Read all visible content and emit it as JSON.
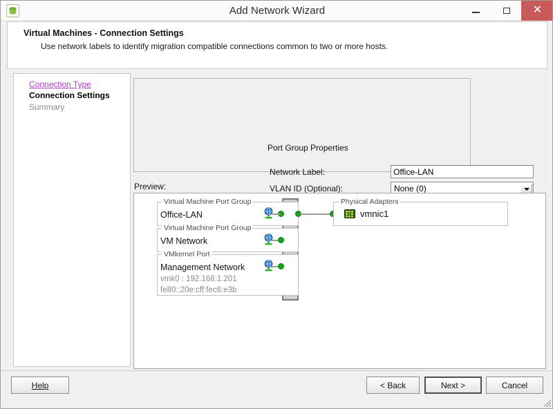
{
  "window": {
    "title": "Add Network Wizard",
    "icon": "vmware-app-icon",
    "controls": {
      "minimize": "–",
      "maximize": "□",
      "close": "✕"
    }
  },
  "header": {
    "title": "Virtual Machines - Connection Settings",
    "subtitle": "Use network labels to identify migration compatible connections common to two or more hosts."
  },
  "sidebar": {
    "items": [
      {
        "label": "Connection Type",
        "state": "visited"
      },
      {
        "label": "Connection Settings",
        "state": "current"
      },
      {
        "label": "Summary",
        "state": "future"
      }
    ]
  },
  "port_group_properties": {
    "legend": "Port Group Properties",
    "network_label": {
      "label": "Network Label:",
      "value": "Office-LAN"
    },
    "vlan_id": {
      "label": "VLAN ID (Optional):",
      "value": "None (0)"
    }
  },
  "preview": {
    "label": "Preview:",
    "port_groups": [
      {
        "legend": "Virtual Machine Port Group",
        "name": "Office-LAN",
        "icon": "globe-network-icon",
        "details": []
      },
      {
        "legend": "Virtual Machine Port Group",
        "name": "VM Network",
        "icon": "globe-network-icon",
        "details": []
      },
      {
        "legend": "VMkernel Port",
        "name": "Management Network",
        "icon": "globe-network-icon",
        "details": [
          "vmk0 : 192.168.1.201",
          "fe80::20e:cff:fec6:e3b"
        ]
      }
    ],
    "physical_adapters": {
      "legend": "Physical Adapters",
      "name": "vmnic1",
      "icon": "nic-adapter-icon"
    }
  },
  "footer": {
    "help": "Help",
    "back": "< Back",
    "next": "Next >",
    "cancel": "Cancel"
  },
  "colors": {
    "accent_link": "#b13cc8",
    "close_button": "#c75b5b",
    "node_green": "#19a319",
    "switch_fill": "#cfcfcf"
  }
}
